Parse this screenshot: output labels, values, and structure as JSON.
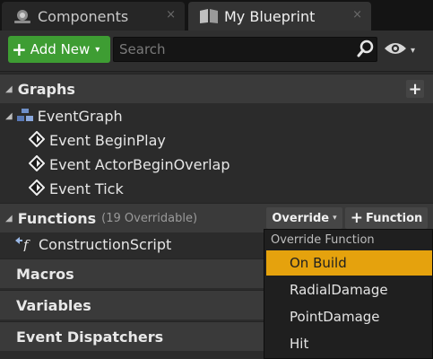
{
  "tabs": [
    {
      "label": "Components",
      "active": false,
      "icon": "components-icon",
      "close": "×"
    },
    {
      "label": "My Blueprint",
      "active": true,
      "icon": "book-icon",
      "close": "×"
    }
  ],
  "toolbar": {
    "add_new_label": "Add New",
    "add_new_plus": "+",
    "caret": "▾",
    "search_placeholder": "Search",
    "search_value": "",
    "search_icon": "search-icon",
    "view_icon": "eye-icon"
  },
  "graphs": {
    "title": "Graphs",
    "add": "+",
    "tree": {
      "label": "EventGraph",
      "icon": "event-graph-icon",
      "events": [
        "Event BeginPlay",
        "Event ActorBeginOverlap",
        "Event Tick"
      ],
      "event_icon": "event-diamond-icon"
    }
  },
  "functions": {
    "title": "Functions",
    "count_label": "(19 Overridable)",
    "override_label": "Override",
    "add_function_label": "Function",
    "add_function_plus": "+",
    "items": [
      {
        "label": "ConstructionScript",
        "icon": "function-icon"
      }
    ]
  },
  "sections": [
    {
      "title": "Macros"
    },
    {
      "title": "Variables"
    },
    {
      "title": "Event Dispatchers"
    }
  ],
  "override_menu": {
    "title": "Override Function",
    "items": [
      {
        "label": "On Build",
        "selected": true
      },
      {
        "label": "RadialDamage",
        "selected": false
      },
      {
        "label": "PointDamage",
        "selected": false
      },
      {
        "label": "Hit",
        "selected": false
      }
    ]
  },
  "colors": {
    "add_new_green": "#3e9d33",
    "highlight_orange": "#e5a20d",
    "panel_bg": "#2b2b2b",
    "header_bg": "#3a3a3a"
  }
}
